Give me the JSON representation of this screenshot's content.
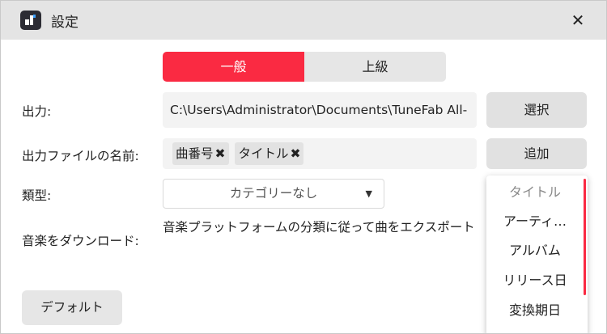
{
  "window": {
    "title": "設定",
    "close_glyph": "✕"
  },
  "tabs": [
    {
      "label": "一般",
      "active": true
    },
    {
      "label": "上級",
      "active": false
    }
  ],
  "output": {
    "label": "出力:",
    "path": "C:\\Users\\Administrator\\Documents\\TuneFab All-",
    "select_button": "選択"
  },
  "filename": {
    "label": "出力ファイルの名前:",
    "tags": [
      {
        "label": "曲番号"
      },
      {
        "label": "タイトル"
      }
    ],
    "add_button": "追加",
    "remove_glyph": "✖"
  },
  "category": {
    "label": "類型:",
    "value": "カテゴリーなし",
    "caret": "▼"
  },
  "download": {
    "label": "音楽をダウンロード:",
    "description": "音楽プラットフォームの分類に従って曲をエクスポート"
  },
  "default_button": "デフォルト",
  "dropdown": {
    "items": [
      {
        "label": "タイトル",
        "dim": true
      },
      {
        "label": "アーティ…"
      },
      {
        "label": "アルバム"
      },
      {
        "label": "リリース日"
      },
      {
        "label": "変換期日"
      }
    ]
  },
  "colors": {
    "accent": "#fa2a42",
    "titlebar": "#e4e4e4"
  }
}
